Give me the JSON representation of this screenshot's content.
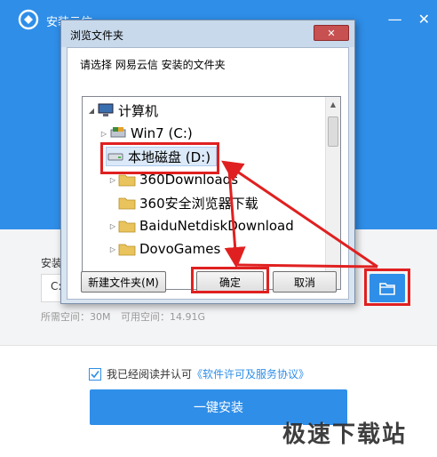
{
  "installer": {
    "title": "安装云信",
    "window_controls": [
      "—",
      "✕"
    ],
    "path_label": "安装",
    "path_value": "C:",
    "space_required": "所需空间：30M",
    "space_available": "可用空间：14.91G",
    "agree_text": "我已经阅读并认可",
    "agree_link": "《软件许可及服务协议》",
    "agree_checked": true,
    "install_button": "一键安装",
    "accent_color": "#2f8ee8"
  },
  "dialog": {
    "title": "浏览文件夹",
    "close_label": "✕",
    "prompt": "请选择 网易云信 安装的文件夹",
    "tree": [
      {
        "label": "计算机",
        "icon": "computer-icon",
        "expanded": true
      },
      {
        "label": "Win7 (C:)",
        "icon": "drive-icon",
        "expanded": false
      },
      {
        "label": "本地磁盘 (D:)",
        "icon": "drive-icon",
        "expanded": true,
        "selected": true
      },
      {
        "label": "360Downloads",
        "icon": "folder-icon"
      },
      {
        "label": "360安全浏览器下载",
        "icon": "folder-icon"
      },
      {
        "label": "BaiduNetdiskDownload",
        "icon": "folder-icon"
      },
      {
        "label": "DovoGames",
        "icon": "folder-icon"
      }
    ],
    "new_folder_button": "新建文件夹(M)",
    "ok_button": "确定",
    "cancel_button": "取消"
  },
  "watermark": "极速下载站",
  "annotation_color": "#e02020"
}
